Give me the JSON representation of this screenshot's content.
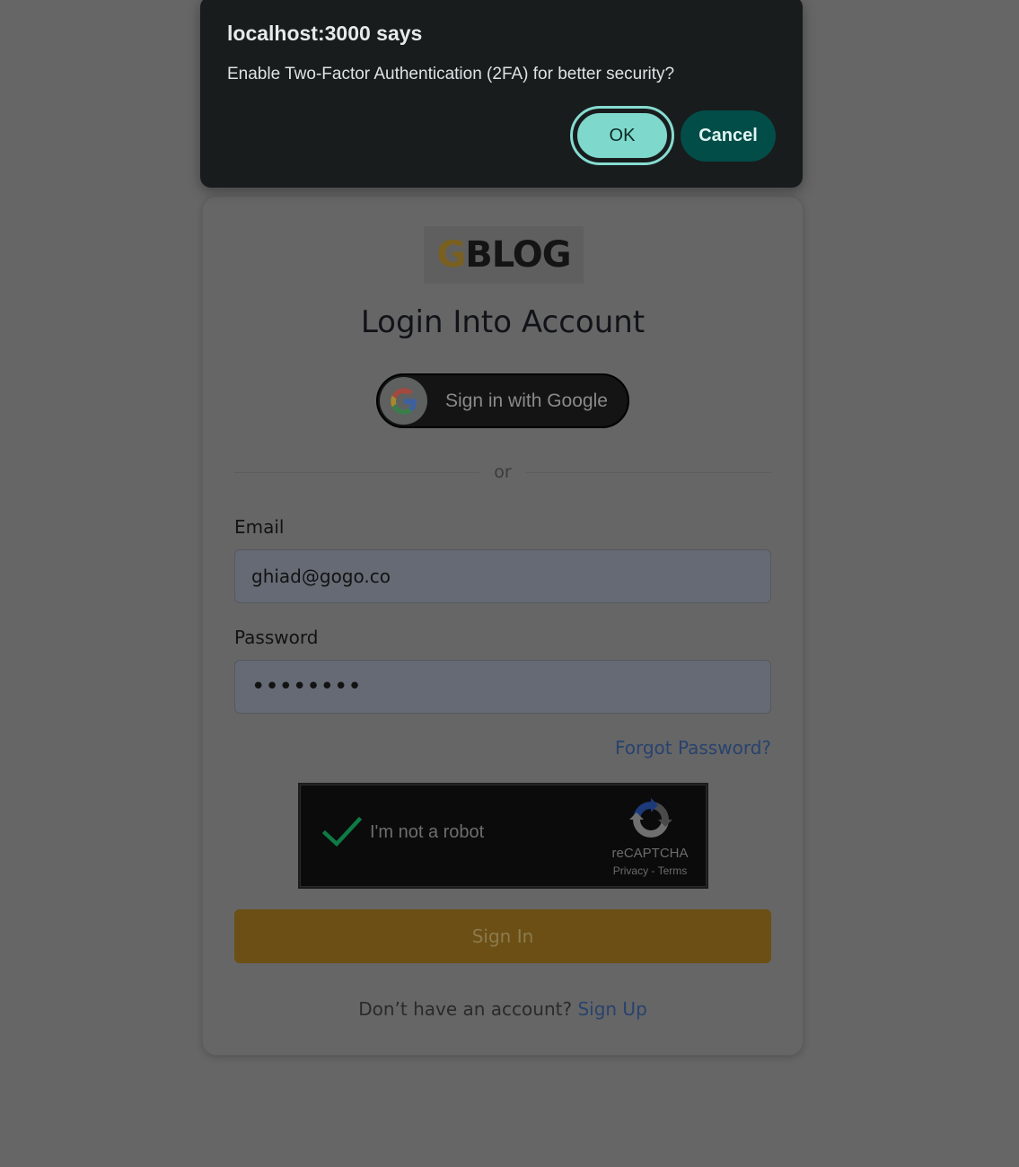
{
  "dialog": {
    "title": "localhost:3000 says",
    "message": "Enable Two-Factor Authentication (2FA) for better security?",
    "ok_label": "OK",
    "cancel_label": "Cancel"
  },
  "login": {
    "logo_g": "G",
    "logo_rest": "BLOG",
    "title": "Login Into Account",
    "google_label": "Sign in with Google",
    "divider_text": "or",
    "email_label": "Email",
    "email_value": "ghiad@gogo.co",
    "password_label": "Password",
    "password_value": "••••••••",
    "forgot_label": "Forgot Password?",
    "signin_label": "Sign In",
    "signup_prompt": "Don’t have an account?",
    "signup_link": "Sign Up"
  },
  "recaptcha": {
    "label": "I'm not a robot",
    "brand": "reCAPTCHA",
    "privacy": "Privacy",
    "separator": " - ",
    "terms": "Terms",
    "checked": true
  },
  "icons": {
    "google": "google-g-icon",
    "checkmark": "checkmark-icon",
    "recaptcha": "recaptcha-logo-icon"
  },
  "colors": {
    "overlay_bg": "#666666",
    "dialog_bg": "#181c1d",
    "ok_button": "#7fd8cc",
    "cancel_button": "#034d48",
    "signin_button": "#6b4f14",
    "link": "#28426e"
  }
}
